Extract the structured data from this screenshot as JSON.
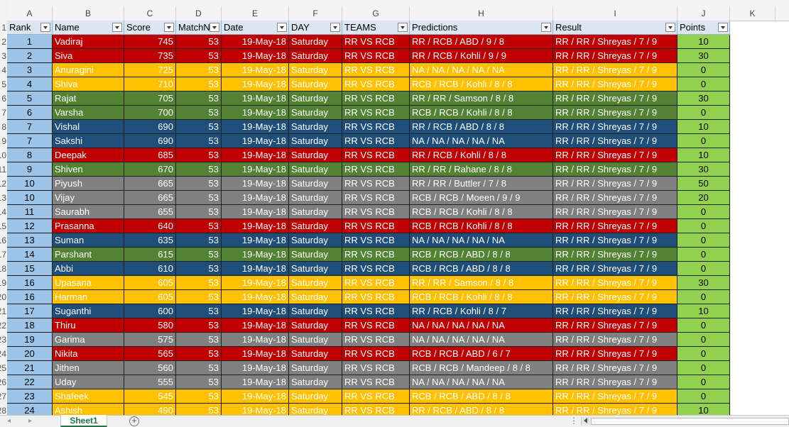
{
  "sheet_tab": "Sheet1",
  "add_sheet_symbol": "+",
  "nav": {
    "prev": "◂",
    "next": "▸",
    "more": "⋮"
  },
  "column_letters": [
    "A",
    "B",
    "C",
    "D",
    "E",
    "F",
    "G",
    "H",
    "I",
    "J",
    "K"
  ],
  "gutter_numbers": [
    "1",
    "2",
    "3",
    "4",
    "5",
    "6",
    "7",
    "8",
    "9",
    "10",
    "11",
    "12",
    "13",
    "14",
    "15",
    "16",
    "17",
    "18",
    "19",
    "20",
    "21",
    "22",
    "23",
    "24",
    "25",
    "26",
    "27",
    "28"
  ],
  "headers": [
    "Rank",
    "Name",
    "Score",
    "MatchN",
    "Date",
    "DAY",
    "TEAMS",
    "Predictions",
    "Result",
    "Points"
  ],
  "team_colors": {
    "red": "#c00000",
    "yellow": "#ffc000",
    "green": "#548235",
    "blue": "#1f4e79",
    "gray": "#808080",
    "points": "#92d050",
    "rank": "#9dc3e6"
  },
  "rows": [
    {
      "rank": "1",
      "name": "Vadiraj",
      "score": "745",
      "match": "53",
      "date": "19-May-18",
      "day": "Saturday",
      "teams": "RR VS RCB",
      "prediction": "RR / RCB / ABD / 9 / 8",
      "result": "RR / RR / Shreyas / 7 / 9",
      "points": "10",
      "color": "red"
    },
    {
      "rank": "2",
      "name": "Siva",
      "score": "735",
      "match": "53",
      "date": "19-May-18",
      "day": "Saturday",
      "teams": "RR VS RCB",
      "prediction": "RR / RCB / Kohli / 9 / 9",
      "result": "RR / RR / Shreyas / 7 / 9",
      "points": "30",
      "color": "red"
    },
    {
      "rank": "3",
      "name": "Anuragini",
      "score": "725",
      "match": "53",
      "date": "19-May-18",
      "day": "Saturday",
      "teams": "RR VS RCB",
      "prediction": "NA / NA / NA / NA / NA",
      "result": "RR / RR / Shreyas / 7 / 9",
      "points": "0",
      "color": "yellow"
    },
    {
      "rank": "4",
      "name": "Shiva",
      "score": "710",
      "match": "53",
      "date": "19-May-18",
      "day": "Saturday",
      "teams": "RR VS RCB",
      "prediction": "RCB / RCB / Kohli / 8 / 8",
      "result": "RR / RR / Shreyas / 7 / 9",
      "points": "0",
      "color": "yellow"
    },
    {
      "rank": "5",
      "name": "Rajat",
      "score": "705",
      "match": "53",
      "date": "19-May-18",
      "day": "Saturday",
      "teams": "RR VS RCB",
      "prediction": "RR / RR / Samson / 8 / 8",
      "result": "RR / RR / Shreyas / 7 / 9",
      "points": "30",
      "color": "green"
    },
    {
      "rank": "6",
      "name": "Varsha",
      "score": "700",
      "match": "53",
      "date": "19-May-18",
      "day": "Saturday",
      "teams": "RR VS RCB",
      "prediction": "RCB / RCB / Kohli / 8 / 8",
      "result": "RR / RR / Shreyas / 7 / 9",
      "points": "0",
      "color": "green"
    },
    {
      "rank": "7",
      "name": "Vishal",
      "score": "690",
      "match": "53",
      "date": "19-May-18",
      "day": "Saturday",
      "teams": "RR VS RCB",
      "prediction": "RR / RCB / ABD / 8 / 8",
      "result": "RR / RR / Shreyas / 7 / 9",
      "points": "10",
      "color": "blue"
    },
    {
      "rank": "7",
      "name": "Sakshi",
      "score": "690",
      "match": "53",
      "date": "19-May-18",
      "day": "Saturday",
      "teams": "RR VS RCB",
      "prediction": "NA / NA / NA / NA / NA",
      "result": "RR / RR / Shreyas / 7 / 9",
      "points": "0",
      "color": "blue"
    },
    {
      "rank": "8",
      "name": "Deepak",
      "score": "685",
      "match": "53",
      "date": "19-May-18",
      "day": "Saturday",
      "teams": "RR VS RCB",
      "prediction": "RR / RCB / Kohli / 8 / 8",
      "result": "RR / RR / Shreyas / 7 / 9",
      "points": "10",
      "color": "red"
    },
    {
      "rank": "9",
      "name": "Shiven",
      "score": "670",
      "match": "53",
      "date": "19-May-18",
      "day": "Saturday",
      "teams": "RR VS RCB",
      "prediction": "RR / RR / Rahane / 8 / 8",
      "result": "RR / RR / Shreyas / 7 / 9",
      "points": "30",
      "color": "green"
    },
    {
      "rank": "10",
      "name": "Piyush",
      "score": "665",
      "match": "53",
      "date": "19-May-18",
      "day": "Saturday",
      "teams": "RR VS RCB",
      "prediction": "RR / RR / Buttler / 7 / 8",
      "result": "RR / RR / Shreyas / 7 / 9",
      "points": "50",
      "color": "gray"
    },
    {
      "rank": "10",
      "name": "Vijay",
      "score": "665",
      "match": "53",
      "date": "19-May-18",
      "day": "Saturday",
      "teams": "RR VS RCB",
      "prediction": "RCB / RCB / Moeen / 9 / 9",
      "result": "RR / RR / Shreyas / 7 / 9",
      "points": "20",
      "color": "gray"
    },
    {
      "rank": "11",
      "name": "Saurabh",
      "score": "655",
      "match": "53",
      "date": "19-May-18",
      "day": "Saturday",
      "teams": "RR VS RCB",
      "prediction": "RCB / RCB / Kohli / 8 / 8",
      "result": "RR / RR / Shreyas / 7 / 9",
      "points": "0",
      "color": "gray"
    },
    {
      "rank": "12",
      "name": "Prasanna",
      "score": "640",
      "match": "53",
      "date": "19-May-18",
      "day": "Saturday",
      "teams": "RR VS RCB",
      "prediction": "RCB / RCB / Kohli / 8 / 8",
      "result": "RR / RR / Shreyas / 7 / 9",
      "points": "0",
      "color": "red"
    },
    {
      "rank": "13",
      "name": "Suman",
      "score": "635",
      "match": "53",
      "date": "19-May-18",
      "day": "Saturday",
      "teams": "RR VS RCB",
      "prediction": "NA / NA / NA / NA / NA",
      "result": "RR / RR / Shreyas / 7 / 9",
      "points": "0",
      "color": "blue"
    },
    {
      "rank": "14",
      "name": "Parshant",
      "score": "615",
      "match": "53",
      "date": "19-May-18",
      "day": "Saturday",
      "teams": "RR VS RCB",
      "prediction": "RCB / RCB / ABD / 8 / 8",
      "result": "RR / RR / Shreyas / 7 / 9",
      "points": "0",
      "color": "green"
    },
    {
      "rank": "15",
      "name": "Abbi",
      "score": "610",
      "match": "53",
      "date": "19-May-18",
      "day": "Saturday",
      "teams": "RR VS RCB",
      "prediction": "RCB / RCB / ABD / 8 / 8",
      "result": "RR / RR / Shreyas / 7 / 9",
      "points": "0",
      "color": "blue"
    },
    {
      "rank": "16",
      "name": "Upasana",
      "score": "605",
      "match": "53",
      "date": "19-May-18",
      "day": "Saturday",
      "teams": "RR VS RCB",
      "prediction": "RR / RR / Samson / 8 / 8",
      "result": "RR / RR / Shreyas / 7 / 9",
      "points": "30",
      "color": "yellow"
    },
    {
      "rank": "16",
      "name": "Harman",
      "score": "605",
      "match": "53",
      "date": "19-May-18",
      "day": "Saturday",
      "teams": "RR VS RCB",
      "prediction": "RCB / RCB / Kohli / 8 / 8",
      "result": "RR / RR / Shreyas / 7 / 9",
      "points": "0",
      "color": "yellow"
    },
    {
      "rank": "17",
      "name": "Suganthi",
      "score": "600",
      "match": "53",
      "date": "19-May-18",
      "day": "Saturday",
      "teams": "RR VS RCB",
      "prediction": "RR / RCB / Kohli / 8 / 7",
      "result": "RR / RR / Shreyas / 7 / 9",
      "points": "10",
      "color": "blue"
    },
    {
      "rank": "18",
      "name": "Thiru",
      "score": "580",
      "match": "53",
      "date": "19-May-18",
      "day": "Saturday",
      "teams": "RR VS RCB",
      "prediction": "NA / NA / NA / NA / NA",
      "result": "RR / RR / Shreyas / 7 / 9",
      "points": "0",
      "color": "red"
    },
    {
      "rank": "19",
      "name": "Garima",
      "score": "575",
      "match": "53",
      "date": "19-May-18",
      "day": "Saturday",
      "teams": "RR VS RCB",
      "prediction": "NA / NA / NA / NA / NA",
      "result": "RR / RR / Shreyas / 7 / 9",
      "points": "0",
      "color": "gray"
    },
    {
      "rank": "20",
      "name": "Nikita",
      "score": "565",
      "match": "53",
      "date": "19-May-18",
      "day": "Saturday",
      "teams": "RR VS RCB",
      "prediction": "RCB / RCB / ABD / 6 / 7",
      "result": "RR / RR / Shreyas / 7 / 9",
      "points": "0",
      "color": "red"
    },
    {
      "rank": "21",
      "name": "Jithen",
      "score": "560",
      "match": "53",
      "date": "19-May-18",
      "day": "Saturday",
      "teams": "RR VS RCB",
      "prediction": "RCB / RCB / Mandeep / 8 / 8",
      "result": "RR / RR / Shreyas / 7 / 9",
      "points": "0",
      "color": "gray"
    },
    {
      "rank": "22",
      "name": "Uday",
      "score": "555",
      "match": "53",
      "date": "19-May-18",
      "day": "Saturday",
      "teams": "RR VS RCB",
      "prediction": "NA / NA / NA / NA / NA",
      "result": "RR / RR / Shreyas / 7 / 9",
      "points": "0",
      "color": "gray"
    },
    {
      "rank": "23",
      "name": "Shafeek",
      "score": "545",
      "match": "53",
      "date": "19-May-18",
      "day": "Saturday",
      "teams": "RR VS RCB",
      "prediction": "RCB / RCB / ABD / 8 / 8",
      "result": "RR / RR / Shreyas / 7 / 9",
      "points": "0",
      "color": "yellow"
    },
    {
      "rank": "24",
      "name": "Ashish",
      "score": "490",
      "match": "53",
      "date": "19-May-18",
      "day": "Saturday",
      "teams": "RR VS RCB",
      "prediction": "RR / RCB / ABD / 8 / 8",
      "result": "RR / RR / Shreyas / 7 / 9",
      "points": "10",
      "color": "yellow"
    }
  ]
}
